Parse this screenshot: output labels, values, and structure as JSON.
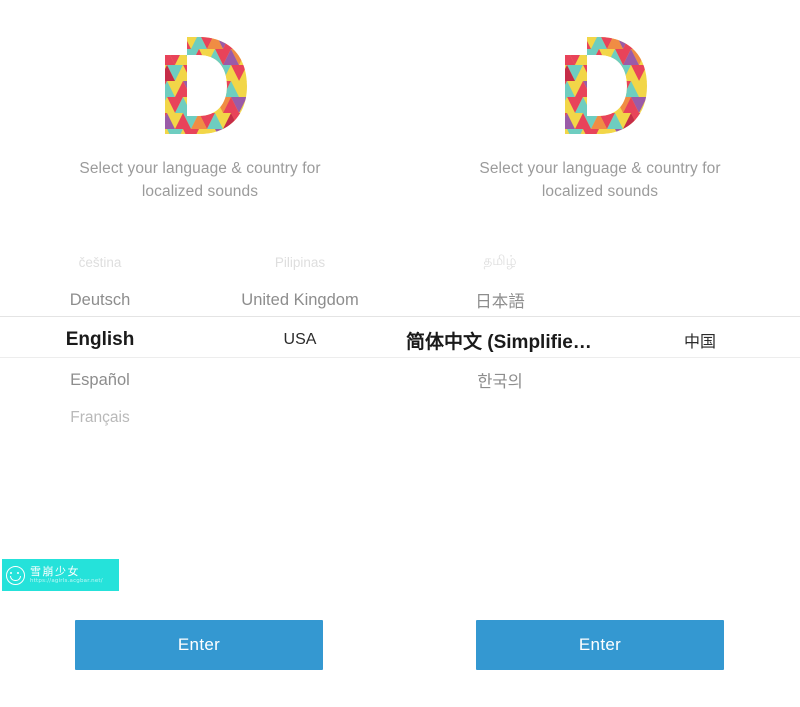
{
  "app": {
    "logo_icon": "letter-d-triangle-mosaic-logo",
    "brand_blue": "#3498d1",
    "watermark_teal": "#25e2da"
  },
  "screens": [
    {
      "id": "left",
      "subtitle": "Select your language & country for localized sounds",
      "picker": {
        "rows": [
          {
            "distance": "d3",
            "language": "čeština",
            "country": "Pilipinas"
          },
          {
            "distance": "d1",
            "language": "Deutsch",
            "country": "United Kingdom"
          },
          {
            "distance": "sel",
            "language": "English",
            "country": "USA"
          },
          {
            "distance": "d1",
            "language": "Español",
            "country": ""
          },
          {
            "distance": "d2",
            "language": "Français",
            "country": ""
          },
          {
            "distance": "d3",
            "language": "",
            "country": ""
          }
        ],
        "selected_language": "English",
        "selected_country": "USA"
      },
      "enter_label": "Enter"
    },
    {
      "id": "right",
      "subtitle": "Select your language & country for localized sounds",
      "picker": {
        "rows": [
          {
            "distance": "d3",
            "language": "தமிழ்",
            "country": ""
          },
          {
            "distance": "d1",
            "language": "日本語",
            "country": ""
          },
          {
            "distance": "sel",
            "language": "简体中文 (Simplified…",
            "country": "中国"
          },
          {
            "distance": "d1",
            "language": "한국의",
            "country": ""
          },
          {
            "distance": "d2",
            "language": "",
            "country": ""
          },
          {
            "distance": "d3",
            "language": "",
            "country": ""
          }
        ],
        "selected_language": "简体中文 (Simplified…",
        "selected_country": "中国"
      },
      "enter_label": "Enter"
    }
  ],
  "watermark": {
    "icon": "smiley-face-icon",
    "title": "雪崩少女",
    "url": "https://agirls.acgbar.net/"
  }
}
